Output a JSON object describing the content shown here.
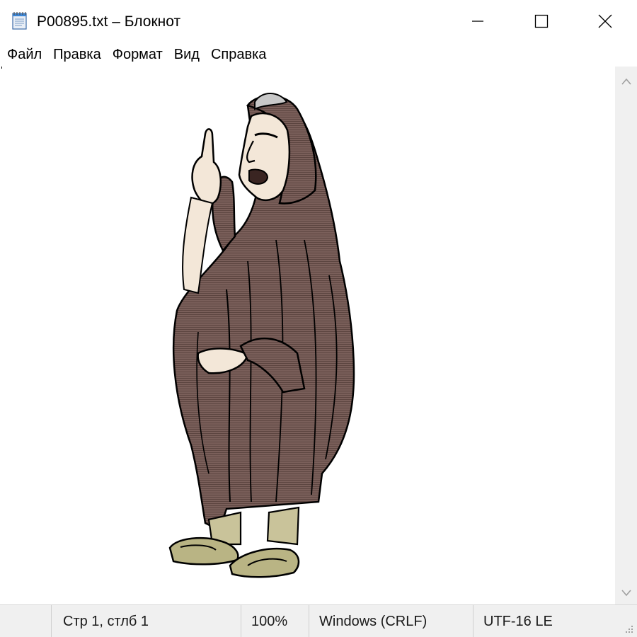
{
  "window": {
    "title": "P00895.txt – Блокнот",
    "icons": {
      "app": "notepad-icon",
      "minimize": "minimize-icon",
      "maximize": "maximize-icon",
      "close": "close-icon"
    }
  },
  "menu": {
    "items": [
      "Файл",
      "Правка",
      "Формат",
      "Вид",
      "Справка"
    ]
  },
  "editor": {
    "content": "Illustration: a person in a long brown hooded robe and sandals, raising one finger while speaking"
  },
  "scrollbar": {
    "up_icon": "chevron-up-icon",
    "down_icon": "chevron-down-icon"
  },
  "status": {
    "position": "Стр 1, стлб 1",
    "zoom": "100%",
    "line_endings": "Windows (CRLF)",
    "encoding": "UTF-16 LE"
  },
  "colors": {
    "robe": "#7a5f5a",
    "robe_dark": "#5c4540",
    "skin": "#f3e7d8",
    "pants": "#c9c39a",
    "sandal": "#b9b484",
    "hair": "#c8c8c8",
    "chrome": "#f0f0f0"
  }
}
